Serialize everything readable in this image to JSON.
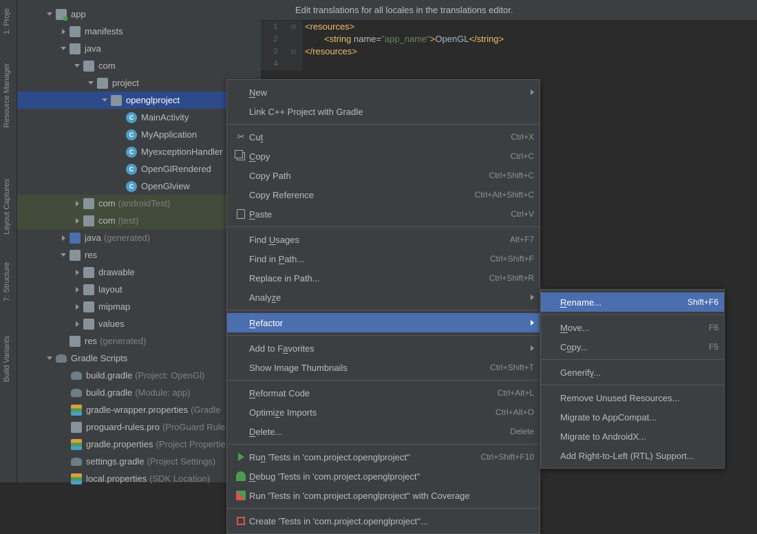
{
  "rail": {
    "project": "1: Proje",
    "resource": "Resource Manager",
    "layout": "Layout Captures",
    "structure": "7: Structure",
    "variants": "Build Variants"
  },
  "tree": {
    "app": "app",
    "manifests": "manifests",
    "java": "java",
    "com": "com",
    "project": "project",
    "openglproject": "openglproject",
    "mainactivity": "MainActivity",
    "myapplication": "MyApplication",
    "myexceptionhandler": "MyexceptionHandler",
    "openglrendered": "OpenGlRendered",
    "openglview": "OpenGlview",
    "com_at": "com",
    "com_at_note": "(androidTest)",
    "com_t": "com",
    "com_t_note": "(test)",
    "java_gen": "java",
    "java_gen_note": "(generated)",
    "res": "res",
    "drawable": "drawable",
    "layout": "layout",
    "mipmap": "mipmap",
    "values": "values",
    "res_gen": "res",
    "res_gen_note": "(generated)",
    "gradle_scripts": "Gradle Scripts",
    "build_p": "build.gradle",
    "build_p_note": "(Project: OpenGl)",
    "build_m": "build.gradle",
    "build_m_note": "(Module: app)",
    "wrapper": "gradle-wrapper.properties",
    "wrapper_note": "(Gradle",
    "proguard": "proguard-rules.pro",
    "proguard_note": "(ProGuard Rule",
    "gp": "gradle.properties",
    "gp_note": "(Project Propertie",
    "sg": "settings.gradle",
    "sg_note": "(Project Settings)",
    "lp": "local.properties",
    "lp_note": "(SDK Location)"
  },
  "editor": {
    "hint": "Edit translations for all locales in the translations editor.",
    "ln1": "1",
    "ln2": "2",
    "ln3": "3",
    "ln4": "4",
    "code": {
      "res_open": "<resources>",
      "string_open": "<string ",
      "name_attr": "name=",
      "name_val": "\"app_name\"",
      "close": ">",
      "content": "OpenGL",
      "string_close": "</string>",
      "res_close": "</resources>"
    }
  },
  "menu": {
    "new": "New",
    "link": "Link C++ Project with Gradle",
    "cut": "Cut",
    "cut_sc": "Ctrl+X",
    "copy": "Copy",
    "copy_sc": "Ctrl+C",
    "copypath": "Copy Path",
    "copypath_sc": "Ctrl+Shift+C",
    "copyref": "Copy Reference",
    "copyref_sc": "Ctrl+Alt+Shift+C",
    "paste": "Paste",
    "paste_sc": "Ctrl+V",
    "findusages": "Find Usages",
    "findusages_sc": "Alt+F7",
    "findinpath": "Find in Path...",
    "findinpath_sc": "Ctrl+Shift+F",
    "replaceinpath": "Replace in Path...",
    "replaceinpath_sc": "Ctrl+Shift+R",
    "analyze": "Analyze",
    "refactor": "Refactor",
    "addtofav": "Add to Favorites",
    "showthumb": "Show Image Thumbnails",
    "showthumb_sc": "Ctrl+Shift+T",
    "reformat": "Reformat Code",
    "reformat_sc": "Ctrl+Alt+L",
    "optimize": "Optimize Imports",
    "optimize_sc": "Ctrl+Alt+O",
    "delete": "Delete...",
    "delete_sc": "Delete",
    "runtests": "Run 'Tests in 'com.project.openglproject''",
    "runtests_sc": "Ctrl+Shift+F10",
    "debugtests": "Debug 'Tests in 'com.project.openglproject''",
    "runcov": "Run 'Tests in 'com.project.openglproject'' with Coverage",
    "createtests": "Create 'Tests in 'com.project.openglproject''..."
  },
  "submenu": {
    "rename": "Rename...",
    "rename_sc": "Shift+F6",
    "move": "Move...",
    "move_sc": "F6",
    "copy": "Copy...",
    "copy_sc": "F5",
    "generify": "Generify...",
    "removeunused": "Remove Unused Resources...",
    "appcompat": "Migrate to AppCompat...",
    "androidx": "Migrate to AndroidX...",
    "rtl": "Add Right-to-Left (RTL) Support..."
  }
}
